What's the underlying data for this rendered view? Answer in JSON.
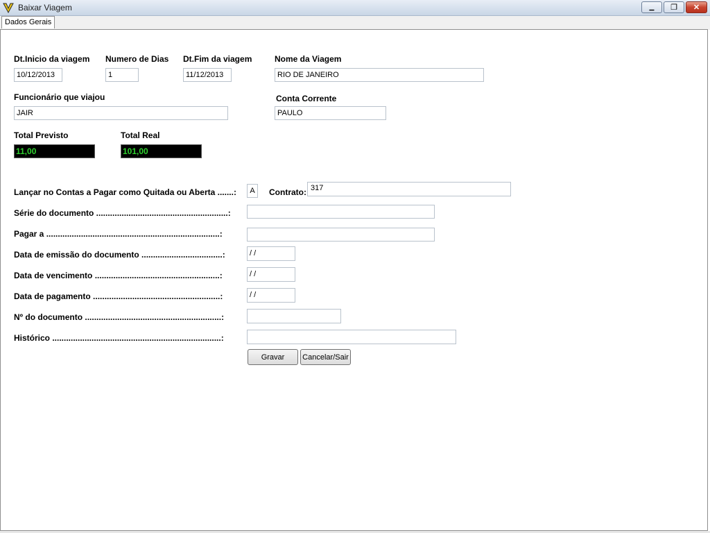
{
  "window": {
    "title": "Baixar Viagem",
    "icon": "app-logo-icon",
    "minimize_glyph": "▁",
    "maximize_glyph": "❐",
    "close_glyph": "✕"
  },
  "tabs": [
    {
      "label": "Dados Gerais",
      "selected": true
    }
  ],
  "trip": {
    "start_date_label": "Dt.Inicio da viagem",
    "start_date_value": "10/12/2013",
    "days_label": "Numero de Dias",
    "days_value": "1",
    "end_date_label": "Dt.Fim da viagem",
    "end_date_value": "11/12/2013",
    "name_label": "Nome da Viagem",
    "name_value": "RIO DE JANEIRO",
    "employee_label": "Funcionário que viajou",
    "employee_value": "JAIR",
    "account_label": "Conta Corrente",
    "account_value": "PAULO",
    "total_expected_label": "Total Previsto",
    "total_expected_value": "11,00",
    "total_real_label": "Total Real",
    "total_real_value": "101,00"
  },
  "payables": {
    "launch_label": "Lançar no Contas a Pagar como Quitada ou Aberta .......:",
    "launch_value": "A",
    "contract_label": "Contrato:",
    "contract_value": "317",
    "series_label": "Série do documento .........................................................:",
    "series_value": "",
    "pay_to_label": "Pagar a ...........................................................................:",
    "pay_to_value": "",
    "issue_date_label": "Data de emissão do documento ...................................:",
    "issue_date_value": " /  /",
    "due_date_label": "Data de vencimento ......................................................:",
    "due_date_value": " /  /",
    "payment_date_label": "Data de pagamento .......................................................:",
    "payment_date_value": " /  /",
    "doc_number_label": "Nº do documento ...........................................................:",
    "doc_number_value": "",
    "history_label": "Histórico .........................................................................:",
    "history_value": ""
  },
  "actions": {
    "save_label": "Gravar",
    "cancel_label": "Cancelar/Sair"
  },
  "colors": {
    "total_bg": "#000000",
    "total_text": "#2fd12f"
  }
}
